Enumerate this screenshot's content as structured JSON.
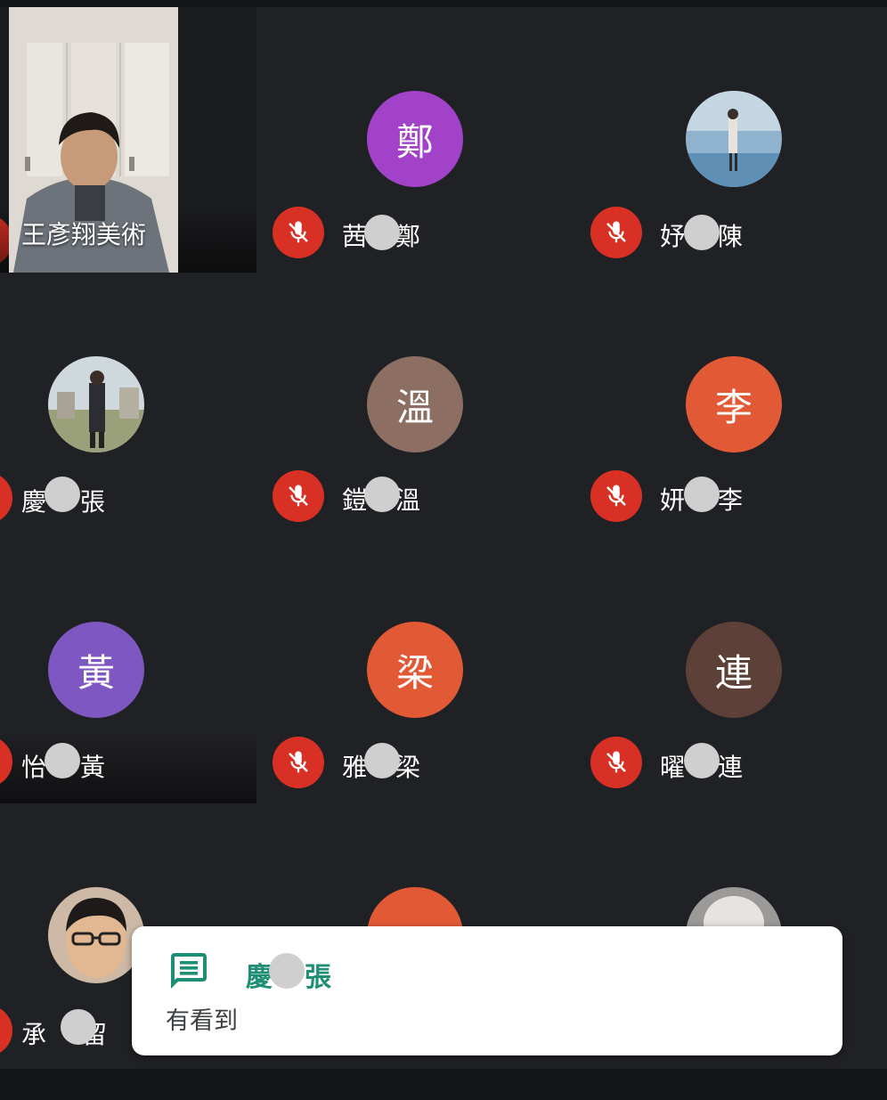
{
  "colors": {
    "background": "#202124",
    "mic_muted_red": "#d93025",
    "chat_sender_green": "#1e8e75",
    "toast_bg": "#ffffff"
  },
  "main_speaker": {
    "name": "王彥翔美術"
  },
  "participants": [
    {
      "initial": "鄭",
      "name_start": "茜",
      "name_end": "鄭",
      "avatar_color": "#a142c8"
    },
    {
      "initial": "",
      "name_start": "妤",
      "name_end": "陳",
      "avatar_type": "photo"
    },
    {
      "initial": "",
      "name_start": "慶",
      "name_end": "張",
      "avatar_type": "photo"
    },
    {
      "initial": "溫",
      "name_start": "鎧",
      "name_end": "溫",
      "avatar_color": "#8d6e63"
    },
    {
      "initial": "李",
      "name_start": "妍",
      "name_end": "李",
      "avatar_color": "#e25a35"
    },
    {
      "initial": "黃",
      "name_start": "怡",
      "name_end": "黃",
      "avatar_color": "#7e57c2"
    },
    {
      "initial": "梁",
      "name_start": "雅",
      "name_end": "梁",
      "avatar_color": "#e25a35"
    },
    {
      "initial": "連",
      "name_start": "曜",
      "name_end": "連",
      "avatar_color": "#5d4037"
    },
    {
      "initial": "",
      "name_start": "承",
      "name_end": "留",
      "avatar_type": "photo"
    }
  ],
  "chat_toast": {
    "icon": "chat-bubble-icon",
    "sender_start": "慶",
    "sender_end": "張",
    "message": "有看到"
  }
}
